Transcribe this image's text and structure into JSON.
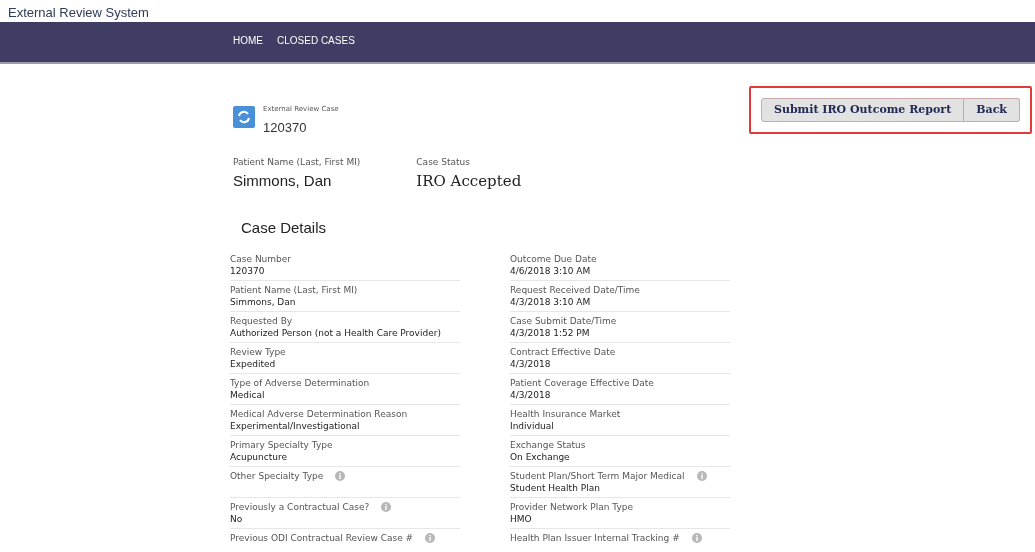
{
  "app_title": "External Review System",
  "nav": [
    {
      "label": "HOME"
    },
    {
      "label": "CLOSED CASES"
    }
  ],
  "record": {
    "type_label": "External Review Case",
    "number": "120370"
  },
  "actions": [
    {
      "label": "Submit IRO Outcome Report"
    },
    {
      "label": "Back"
    }
  ],
  "highlights": [
    {
      "label": "Patient Name (Last, First MI)",
      "value": "Simmons, Dan",
      "kind": "sans"
    },
    {
      "label": "Case Status",
      "value": "IRO Accepted",
      "kind": "serif"
    }
  ],
  "section_title": "Case Details",
  "left_fields": [
    {
      "label": "Case Number",
      "value": "120370",
      "info": false
    },
    {
      "label": "Patient Name (Last, First MI)",
      "value": "Simmons, Dan",
      "info": false
    },
    {
      "label": "Requested By",
      "value": "Authorized Person (not a Health Care Provider)",
      "info": false
    },
    {
      "label": "Review Type",
      "value": "Expedited",
      "info": false
    },
    {
      "label": "Type of Adverse Determination",
      "value": "Medical",
      "info": false
    },
    {
      "label": "Medical Adverse Determination Reason",
      "value": "Experimental/Investigational",
      "info": false
    },
    {
      "label": "Primary Specialty Type",
      "value": "Acupuncture",
      "info": false
    },
    {
      "label": "Other Specialty Type",
      "info": true
    },
    {
      "label": "Previously a Contractual Case?",
      "value": "No",
      "info": true
    },
    {
      "label": "Previous ODI Contractual Review Case #",
      "info": true
    }
  ],
  "right_fields": [
    {
      "label": "Outcome Due Date",
      "value": "4/6/2018 3:10 AM",
      "info": false
    },
    {
      "label": "Request Received Date/Time",
      "value": "4/3/2018 3:10 AM",
      "info": false
    },
    {
      "label": "Case Submit Date/Time",
      "value": "4/3/2018 1:52 PM",
      "info": false
    },
    {
      "label": "Contract Effective Date",
      "value": "4/3/2018",
      "info": false
    },
    {
      "label": "Patient Coverage Effective Date",
      "value": "4/3/2018",
      "info": false
    },
    {
      "label": "Health Insurance Market",
      "value": "Individual",
      "info": false
    },
    {
      "label": "Exchange Status",
      "value": "On Exchange",
      "info": false
    },
    {
      "label": "Student Plan/Short Term Major Medical",
      "value": "Student Health Plan",
      "info": true
    },
    {
      "label": "Provider Network Plan Type",
      "value": "HMO",
      "info": false
    },
    {
      "label": "Health Plan Issuer Internal Tracking #",
      "info": true
    }
  ]
}
